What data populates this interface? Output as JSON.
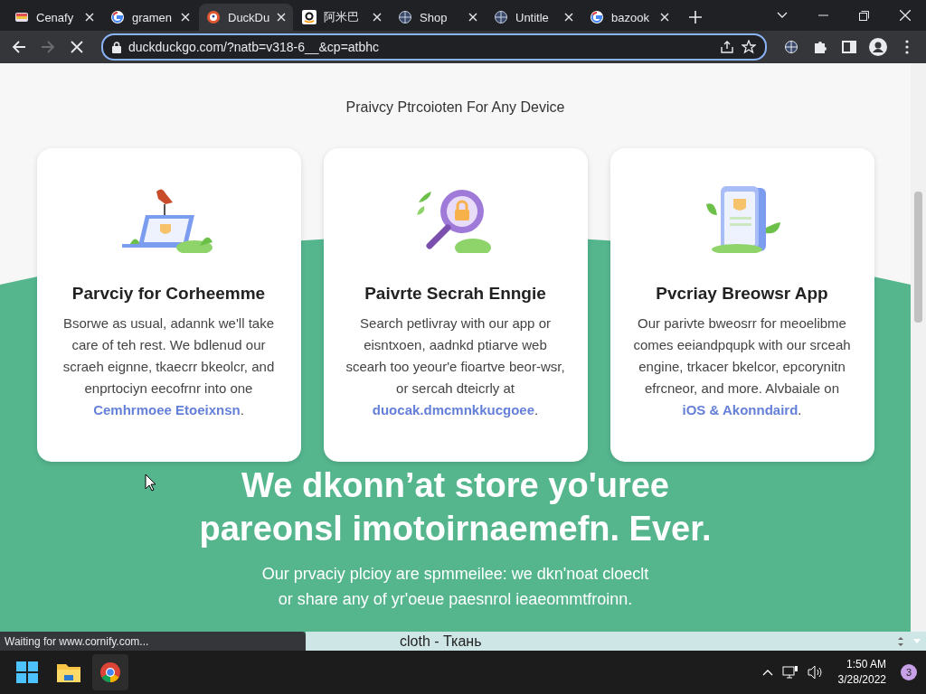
{
  "tabs": [
    {
      "title": "Cenafy",
      "selected": false
    },
    {
      "title": "gramen",
      "selected": false
    },
    {
      "title": "DuckDu",
      "selected": true
    },
    {
      "title": "阿米巴",
      "selected": false
    },
    {
      "title": "Shop",
      "selected": false
    },
    {
      "title": "Untitle",
      "selected": false
    },
    {
      "title": "bazook",
      "selected": false
    }
  ],
  "address_bar": {
    "value": "duckduckgo.com/?natb=v318-6__&cp=atbhc",
    "loading": true
  },
  "page": {
    "heading": "Praivcy Ptrcoioten For Any Device",
    "cards": [
      {
        "title": "Parvciy for Corheemme",
        "body": "Bsorwe as usual, adannk we'll take care of teh rest. We bdlenud our scraeh eignne, tkaecrr bkeolcr, and enprtociyn eecofrnr into one ",
        "link": "Cemhrmoee Etoeixnsn",
        "end": "."
      },
      {
        "title": "Paivrte Secrah Enngie",
        "body": "Search petlivray with our app or eisntxoen, aadnkd ptiarve web scearh too yeour'e fioartve beor-wsr, or sercah dteicrly at ",
        "link": "duocak.dmcmnkkucgoee",
        "end": "."
      },
      {
        "title": "Pvcriay Breowsr App",
        "body": "Our parivte bweosrr for meoelibme comes eeiandpqupk with our srceah engine, trkacer bkelcor, epcorynitn efrcneor, and more. Alvbaiale on ",
        "link": "iOS & Akonndaird",
        "end": "."
      }
    ],
    "headline": [
      "We dkonn’at store yo'uree",
      "pareonsl imotoirnaemefn. Ever."
    ],
    "subtext": [
      "Our prvaciy plcioy are spmmeilee: we dkn'noat cloeclt",
      "or share any of yr'oeue paesnrol ieaeommtfroinn."
    ]
  },
  "status_text": "Waiting for www.cornify.com...",
  "overlay_bar": {
    "text": "cloth - Ткань"
  },
  "taskbar": {
    "time": "1:50 AM",
    "date": "3/28/2022",
    "notifications": "3"
  }
}
